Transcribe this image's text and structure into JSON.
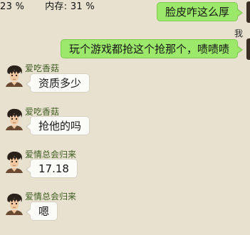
{
  "status": {
    "left_value": "23 %",
    "memory_label": "内存:",
    "memory_value": "31 %"
  },
  "chat": {
    "self_name": "我",
    "messages": [
      {
        "direction": "out",
        "text": "脸皮咋这么厚"
      },
      {
        "direction": "out",
        "sender": "我",
        "text": "玩个游戏都抢这个抢那个，啧啧啧"
      },
      {
        "direction": "in",
        "sender": "爱吃香菇",
        "text": "资质多少"
      },
      {
        "direction": "in",
        "sender": "爱吃香菇",
        "text": "抢他的吗"
      },
      {
        "direction": "in",
        "sender": "爱情总会归来",
        "text": "17.18"
      },
      {
        "direction": "in",
        "sender": "爱情总会归来",
        "text": "嗯"
      }
    ]
  },
  "colors": {
    "background": "#e8e1cf",
    "incoming_bubble": "#fbfbf8",
    "outgoing_bubble": "#9be86a",
    "sender_name": "#3d5b20"
  },
  "icons": {
    "contact_avatar": "avatar-icon"
  }
}
